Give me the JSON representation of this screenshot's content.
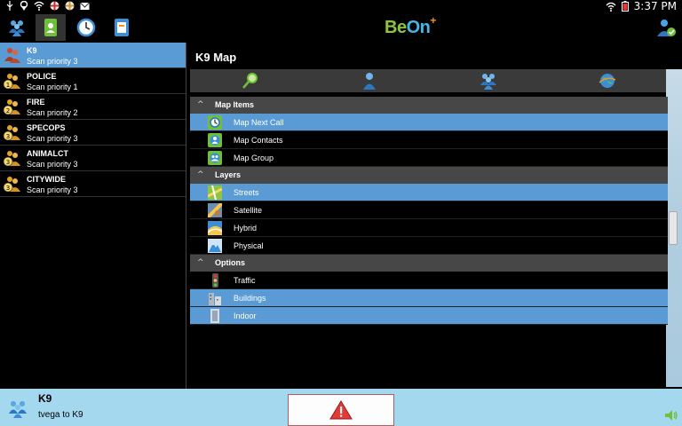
{
  "status_bar": {
    "clock": "3:37 PM",
    "icons": [
      "usb-icon",
      "location-icon",
      "wifi-icon",
      "app-icon",
      "app-icon",
      "mail-icon",
      "wifi-icon",
      "battery-icon"
    ]
  },
  "app": {
    "brand_be": "Be",
    "brand_on": "On",
    "brand_plus": "+",
    "tabs": [
      {
        "icon": "channels-icon"
      },
      {
        "icon": "contacts-icon"
      },
      {
        "icon": "history-icon"
      },
      {
        "icon": "settings-icon"
      }
    ],
    "accent": "#5b9bd5"
  },
  "channels": [
    {
      "name": "K9",
      "priority": "Scan priority 3",
      "badge": "",
      "selected": true
    },
    {
      "name": "POLICE",
      "priority": "Scan priority 1",
      "badge": "1",
      "selected": false
    },
    {
      "name": "FIRE",
      "priority": "Scan priority 2",
      "badge": "2",
      "selected": false
    },
    {
      "name": "SPECOPS",
      "priority": "Scan priority 3",
      "badge": "3",
      "selected": false
    },
    {
      "name": "ANIMALCT",
      "priority": "Scan priority 3",
      "badge": "3",
      "selected": false
    },
    {
      "name": "CITYWIDE",
      "priority": "Scan priority 3",
      "badge": "3",
      "selected": false
    }
  ],
  "main": {
    "title": "K9 Map",
    "toolbar": [
      {
        "icon": "locate-icon"
      },
      {
        "icon": "contact-icon"
      },
      {
        "icon": "group-icon"
      },
      {
        "icon": "globe-icon"
      }
    ],
    "sections": [
      {
        "label": "Map Items",
        "items": [
          {
            "label": "Map Next Call",
            "selected": true,
            "icon": "next-call-icon"
          },
          {
            "label": "Map Contacts",
            "selected": false,
            "icon": "contacts-map-icon"
          },
          {
            "label": "Map Group",
            "selected": false,
            "icon": "group-map-icon"
          }
        ]
      },
      {
        "label": "Layers",
        "items": [
          {
            "label": "Streets",
            "selected": true,
            "icon": "streets-icon"
          },
          {
            "label": "Satellite",
            "selected": false,
            "icon": "satellite-icon"
          },
          {
            "label": "Hybrid",
            "selected": false,
            "icon": "hybrid-icon"
          },
          {
            "label": "Physical",
            "selected": false,
            "icon": "physical-icon"
          }
        ]
      },
      {
        "label": "Options",
        "items": [
          {
            "label": "Traffic",
            "selected": false,
            "icon": "traffic-icon"
          },
          {
            "label": "Buildings",
            "selected": true,
            "icon": "buildings-icon"
          },
          {
            "label": "Indoor",
            "selected": true,
            "icon": "indoor-icon"
          }
        ]
      }
    ]
  },
  "bottom": {
    "channel": "K9",
    "subtitle": "tvega to K9"
  }
}
